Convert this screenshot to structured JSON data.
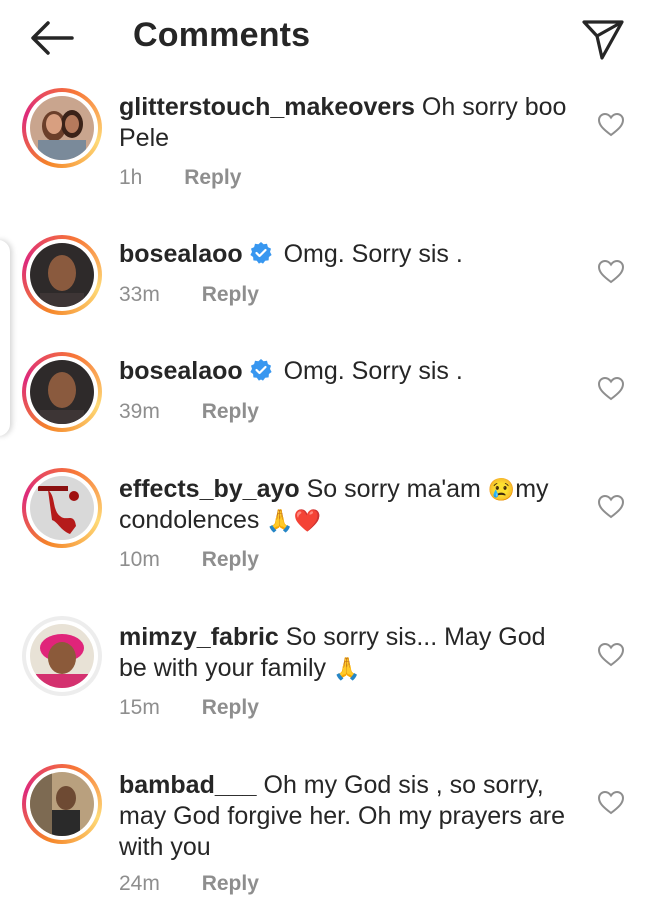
{
  "header": {
    "title": "Comments",
    "back_icon": "arrow-left-icon",
    "share_icon": "paper-plane-icon"
  },
  "comments": [
    {
      "username": "glitterstouch_makeovers",
      "verified": false,
      "text": "Oh sorry boo Pele",
      "time": "1h",
      "reply": "Reply"
    },
    {
      "username": "bosealaoo",
      "verified": true,
      "text": "Omg. Sorry sis .",
      "time": "33m",
      "reply": "Reply"
    },
    {
      "username": "bosealaoo",
      "verified": true,
      "text": "Omg. Sorry sis .",
      "time": "39m",
      "reply": "Reply"
    },
    {
      "username": "effects_by_ayo",
      "verified": false,
      "text": "So sorry ma'am",
      "text2": "my condolences",
      "emojis": [
        "😢",
        "🙏",
        "❤️"
      ],
      "time": "10m",
      "reply": "Reply"
    },
    {
      "username": "mimzy_fabric",
      "verified": false,
      "text": "So sorry sis... May God be with your family",
      "emojis": [
        "🙏"
      ],
      "time": "15m",
      "reply": "Reply"
    },
    {
      "username": "bambad___",
      "verified": false,
      "text": "Oh my God sis , so sorry, may God forgive her. Oh my prayers are with you",
      "time": "24m",
      "reply": "Reply"
    }
  ],
  "colors": {
    "text": "#262626",
    "muted": "#8e8e8e",
    "verified": "#3897f0",
    "story_ring": "#dd2a7b"
  }
}
